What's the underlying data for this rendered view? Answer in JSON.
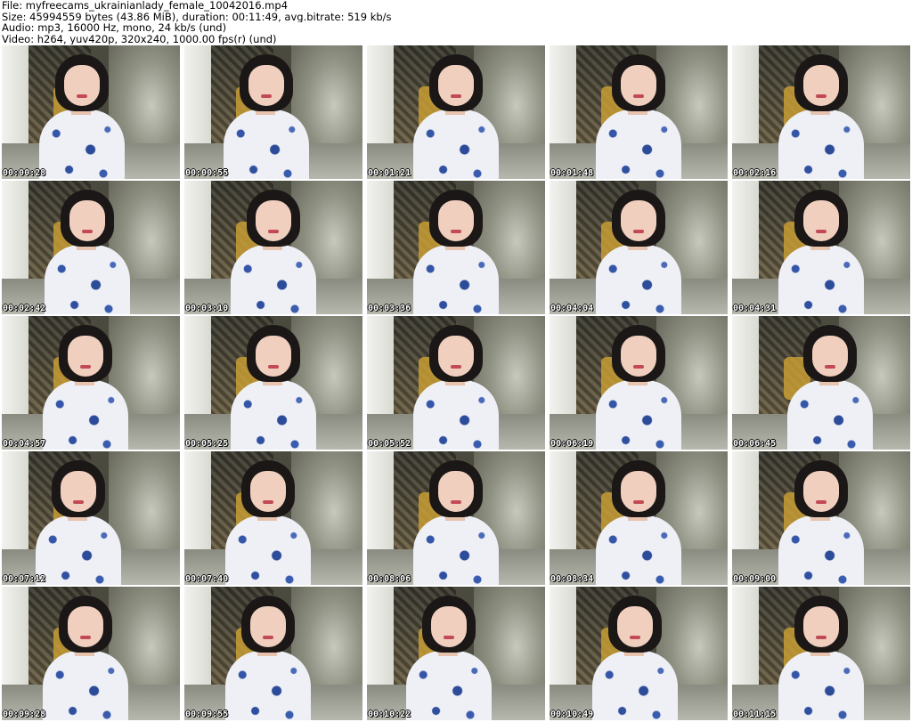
{
  "header": {
    "file_line": "File: myfreecams_ukrainianlady_female_10042016.mp4",
    "size_line": "Size: 45994559 bytes (43.86 MiB), duration: 00:11:49, avg.bitrate: 519 kb/s",
    "audio_line": "Audio: mp3, 16000 Hz, mono, 24 kb/s (und)",
    "video_line": "Video: h264, yuv420p, 320x240, 1000.00 fps(r) (und)"
  },
  "thumbnails": [
    {
      "timestamp": "00:00:28"
    },
    {
      "timestamp": "00:00:55"
    },
    {
      "timestamp": "00:01:21"
    },
    {
      "timestamp": "00:01:48"
    },
    {
      "timestamp": "00:02:16"
    },
    {
      "timestamp": "00:02:42"
    },
    {
      "timestamp": "00:03:10"
    },
    {
      "timestamp": "00:03:36"
    },
    {
      "timestamp": "00:04:04"
    },
    {
      "timestamp": "00:04:31"
    },
    {
      "timestamp": "00:04:57"
    },
    {
      "timestamp": "00:05:25"
    },
    {
      "timestamp": "00:05:52"
    },
    {
      "timestamp": "00:06:19"
    },
    {
      "timestamp": "00:06:45"
    },
    {
      "timestamp": "00:07:12"
    },
    {
      "timestamp": "00:07:40"
    },
    {
      "timestamp": "00:08:06"
    },
    {
      "timestamp": "00:08:34"
    },
    {
      "timestamp": "00:09:00"
    },
    {
      "timestamp": "00:09:28"
    },
    {
      "timestamp": "00:09:55"
    },
    {
      "timestamp": "00:10:22"
    },
    {
      "timestamp": "00:10:49"
    },
    {
      "timestamp": "00:11:15"
    }
  ]
}
